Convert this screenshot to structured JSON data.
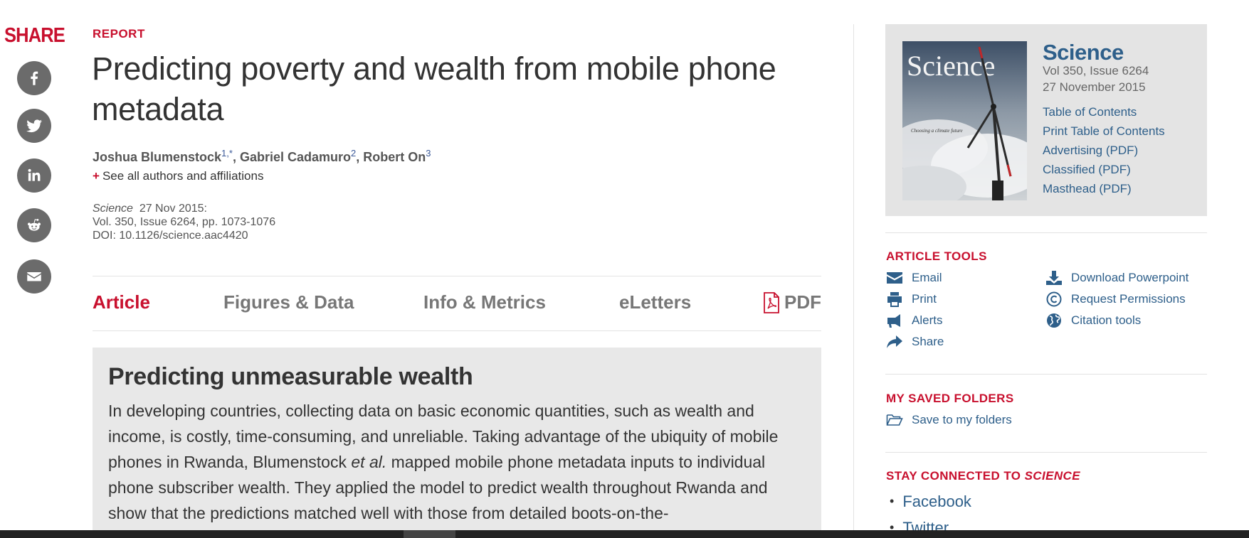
{
  "share": {
    "label": "SHARE",
    "buttons": [
      "facebook-icon",
      "twitter-icon",
      "linkedin-icon",
      "reddit-icon",
      "email-icon"
    ],
    "button_color": "#6b6b6b"
  },
  "article": {
    "type_label": "REPORT",
    "title": "Predicting poverty and wealth from mobile phone metadata",
    "authors": [
      {
        "name": "Joshua Blumenstock",
        "sup": "1,*",
        "sep": ", "
      },
      {
        "name": "Gabriel Cadamuro",
        "sup": "2",
        "sep": ", "
      },
      {
        "name": "Robert On",
        "sup": "3",
        "sep": ""
      }
    ],
    "see_all": "See all authors and affiliations",
    "citation": {
      "journal": "Science",
      "date": "27 Nov 2015:",
      "volume_line": "Vol. 350, Issue 6264, pp. 1073-1076",
      "doi_line": "DOI: 10.1126/science.aac4420"
    }
  },
  "tabs": [
    {
      "label": "Article",
      "active": true
    },
    {
      "label": "Figures & Data",
      "active": false
    },
    {
      "label": "Info & Metrics",
      "active": false
    },
    {
      "label": "eLetters",
      "active": false
    },
    {
      "label": "PDF",
      "active": false
    }
  ],
  "summary": {
    "heading": "Predicting unmeasurable wealth",
    "text_before_italic": "In developing countries, collecting data on basic economic quantities, such as wealth and income, is costly, time-consuming, and unreliable. Taking advantage of the ubiquity of mobile phones in Rwanda, Blumenstock ",
    "italic": "et al.",
    "text_after_italic": " mapped mobile phone metadata inputs to individual phone subscriber wealth. They applied the model to predict wealth throughout Rwanda and show that the predictions matched well with those from detailed boots-on-the-"
  },
  "issue": {
    "journal": "Science",
    "vol": "Vol 350, Issue 6264",
    "date": "27 November 2015",
    "links": [
      "Table of Contents",
      "Print Table of Contents",
      "Advertising (PDF)",
      "Classified (PDF)",
      "Masthead (PDF)"
    ],
    "cover_title": "Science",
    "cover_caption": "Choosing a climate future"
  },
  "article_tools": {
    "title": "ARTICLE TOOLS",
    "left": [
      {
        "label": "Email",
        "icon": "email-icon"
      },
      {
        "label": "Print",
        "icon": "print-icon"
      },
      {
        "label": "Alerts",
        "icon": "megaphone-icon"
      },
      {
        "label": "Share",
        "icon": "share-arrow-icon"
      }
    ],
    "right": [
      {
        "label": "Download Powerpoint",
        "icon": "download-icon"
      },
      {
        "label": "Request Permissions",
        "icon": "copyright-icon"
      },
      {
        "label": "Citation tools",
        "icon": "globe-icon"
      }
    ]
  },
  "saved_folders": {
    "title": "MY SAVED FOLDERS",
    "action": "Save to my folders"
  },
  "stay_connected": {
    "title_prefix": "STAY CONNECTED TO ",
    "title_italic": "SCIENCE",
    "links": [
      "Facebook",
      "Twitter"
    ]
  },
  "colors": {
    "accent_red": "#c8102e",
    "link_blue": "#2e5f8a",
    "box_gray": "#e4e4e4"
  }
}
